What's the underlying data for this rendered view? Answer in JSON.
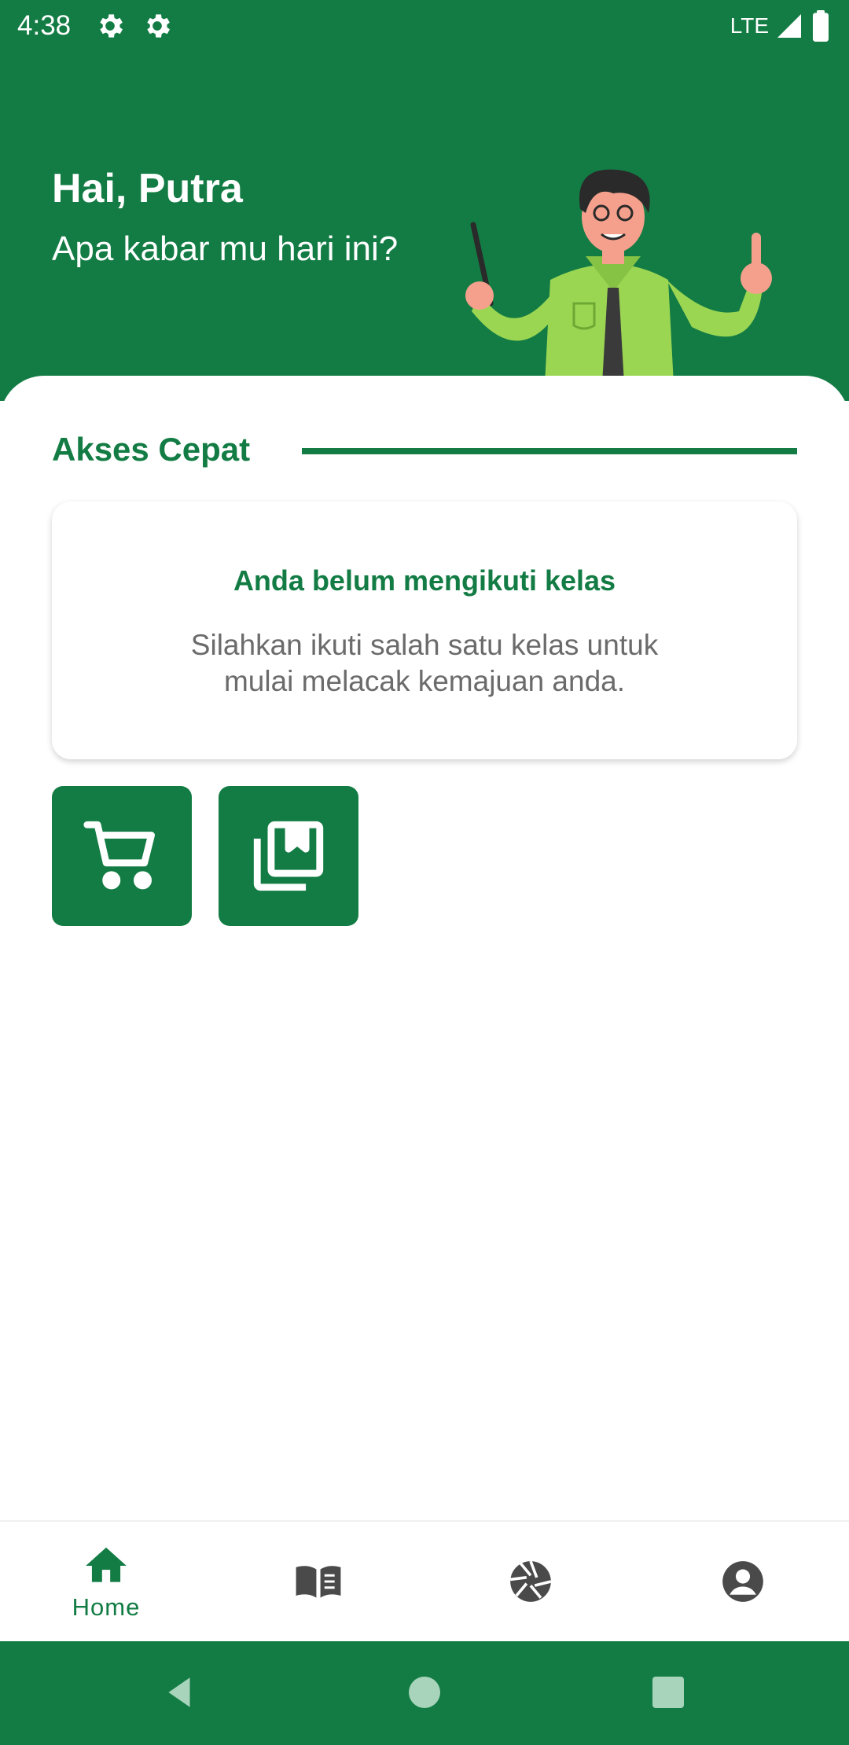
{
  "status_bar": {
    "time": "4:38",
    "network": "LTE",
    "icons": [
      "gear-icon",
      "gear-icon",
      "signal-icon",
      "battery-icon"
    ]
  },
  "header": {
    "greeting": "Hai, Putra",
    "subtitle": "Apa kabar mu hari ini?"
  },
  "quick_access": {
    "title": "Akses Cepat",
    "empty_title": "Anda belum mengikuti kelas",
    "empty_description": "Silahkan ikuti salah satu kelas untuk mulai melacak kemajuan anda.",
    "buttons": [
      {
        "icon": "shopping-cart-icon"
      },
      {
        "icon": "library-bookmark-icon"
      }
    ]
  },
  "bottom_nav": {
    "items": [
      {
        "icon": "home-icon",
        "label": "Home",
        "active": true
      },
      {
        "icon": "book-icon",
        "label": ""
      },
      {
        "icon": "camera-aperture-icon",
        "label": ""
      },
      {
        "icon": "account-circle-icon",
        "label": ""
      }
    ]
  },
  "colors": {
    "primary": "#137c44",
    "illustration_shirt": "#9bd653",
    "text_gray": "#6b6b6b",
    "nav_inactive": "#4a4a4a"
  }
}
